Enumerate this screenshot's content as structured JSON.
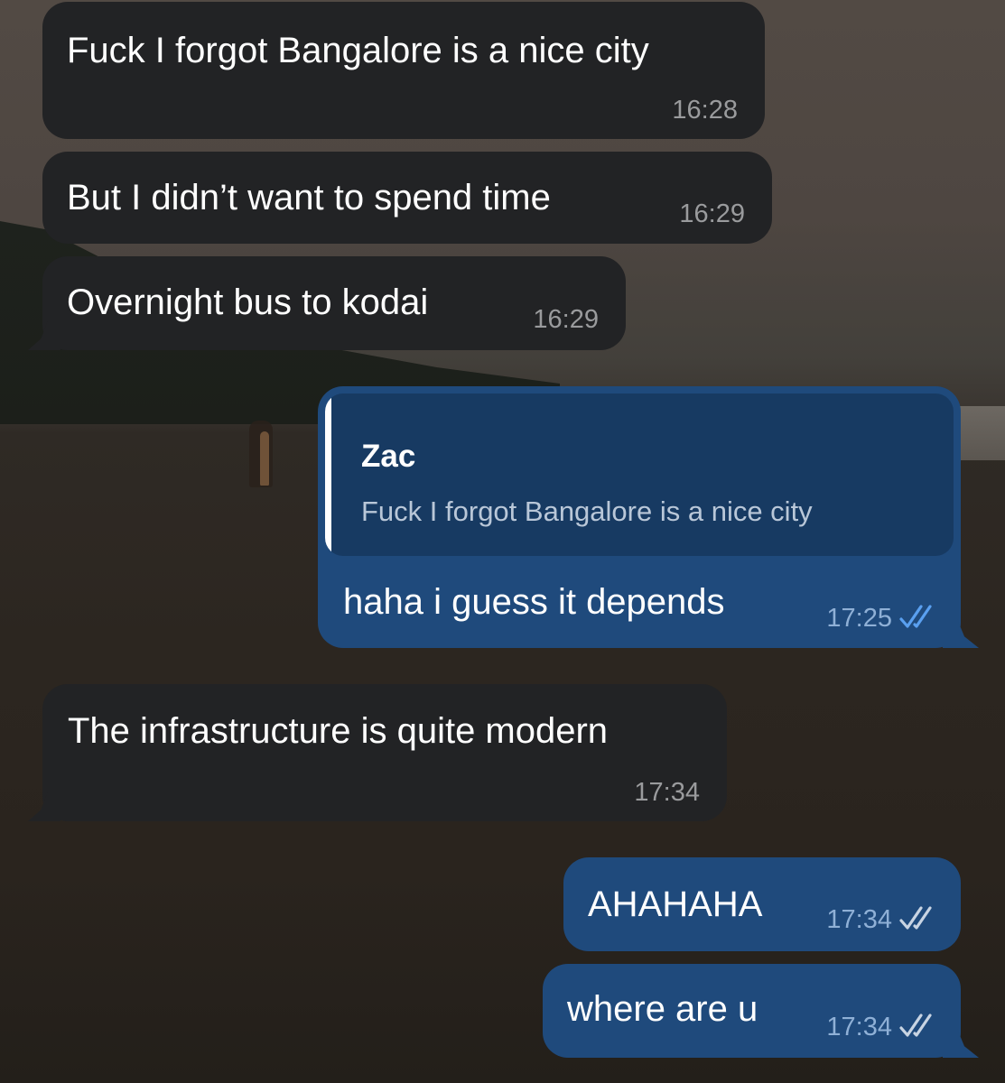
{
  "messages": [
    {
      "text": "Fuck I forgot Bangalore is a nice city",
      "time": "16:28"
    },
    {
      "text": "But I didn’t want to spend time",
      "time": "16:29"
    },
    {
      "text": "Overnight bus to kodai",
      "time": "16:29"
    },
    {
      "text": "haha i guess it depends",
      "time": "17:25",
      "read_status": "double-check-icon",
      "reply": {
        "name": "Zac",
        "text": "Fuck I forgot Bangalore is a nice city"
      }
    },
    {
      "text": "The infrastructure is quite modern",
      "time": "17:34"
    },
    {
      "text": "AHAHAHA",
      "time": "17:34",
      "read_status": "double-check-icon"
    },
    {
      "text": "where are u",
      "time": "17:34",
      "read_status": "double-check-icon"
    }
  ],
  "colors": {
    "incoming_bubble": "#222325",
    "outgoing_bubble": "#1f4a7c",
    "reply_quote": "#173a62",
    "read_check": "#5aa0f0",
    "sent_check": "#c8d4e3"
  }
}
